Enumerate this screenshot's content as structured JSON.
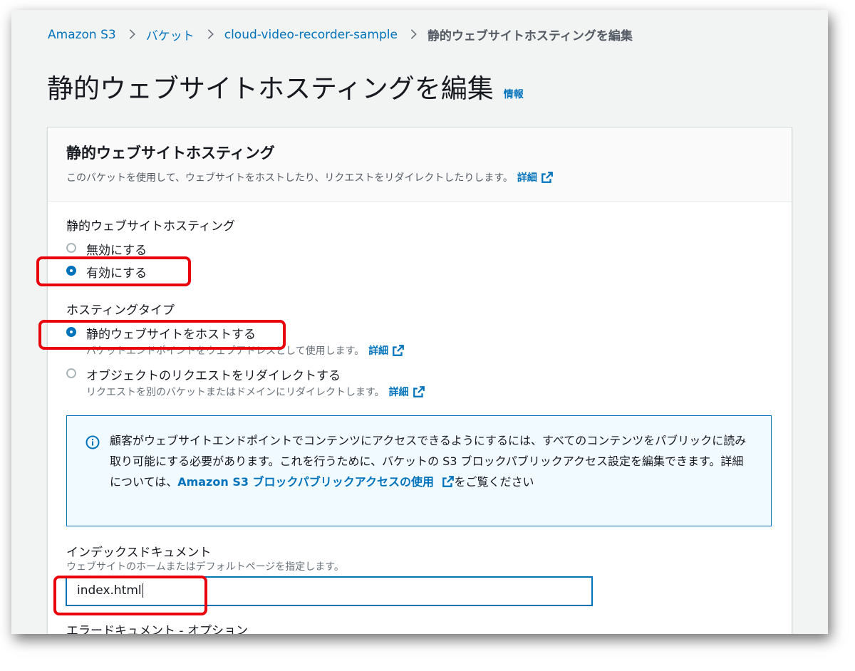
{
  "breadcrumb": {
    "items": [
      "Amazon S3",
      "バケット",
      "cloud-video-recorder-sample"
    ],
    "current": "静的ウェブサイトホスティングを編集"
  },
  "page": {
    "title": "静的ウェブサイトホスティングを編集",
    "info_link": "情報"
  },
  "panel": {
    "title": "静的ウェブサイトホスティング",
    "description": "このバケットを使用して、ウェブサイトをホストしたり、リクエストをリダイレクトしたりします。",
    "detail_link": "詳細"
  },
  "hosting": {
    "label": "静的ウェブサイトホスティング",
    "options": [
      {
        "label": "無効にする",
        "checked": false
      },
      {
        "label": "有効にする",
        "checked": true
      }
    ]
  },
  "hosting_type": {
    "label": "ホスティングタイプ",
    "options": [
      {
        "label": "静的ウェブサイトをホストする",
        "description": "バケットエンドポイントをウェブアドレスとして使用します。",
        "link": "詳細",
        "checked": true
      },
      {
        "label": "オブジェクトのリクエストをリダイレクトする",
        "description": "リクエストを別のバケットまたはドメインにリダイレクトします。",
        "link": "詳細",
        "checked": false
      }
    ]
  },
  "alert": {
    "text_before": "顧客がウェブサイトエンドポイントでコンテンツにアクセスできるようにするには、すべてのコンテンツをパブリックに読み取り可能にする必要があります。これを行うために、バケットの S3 ブロックパブリックアクセス設定を編集できます。詳細については、",
    "link": "Amazon S3 ブロックパブリックアクセスの使用",
    "text_after": "をご覧ください"
  },
  "index_document": {
    "label": "インデックスドキュメント",
    "hint": "ウェブサイトのホームまたはデフォルトページを指定します。",
    "value": "index.html"
  },
  "error_document": {
    "label": "エラードキュメント - オプション"
  },
  "colors": {
    "link": "#0073bb",
    "highlight": "#e8000d",
    "background": "#f2f3f3"
  }
}
